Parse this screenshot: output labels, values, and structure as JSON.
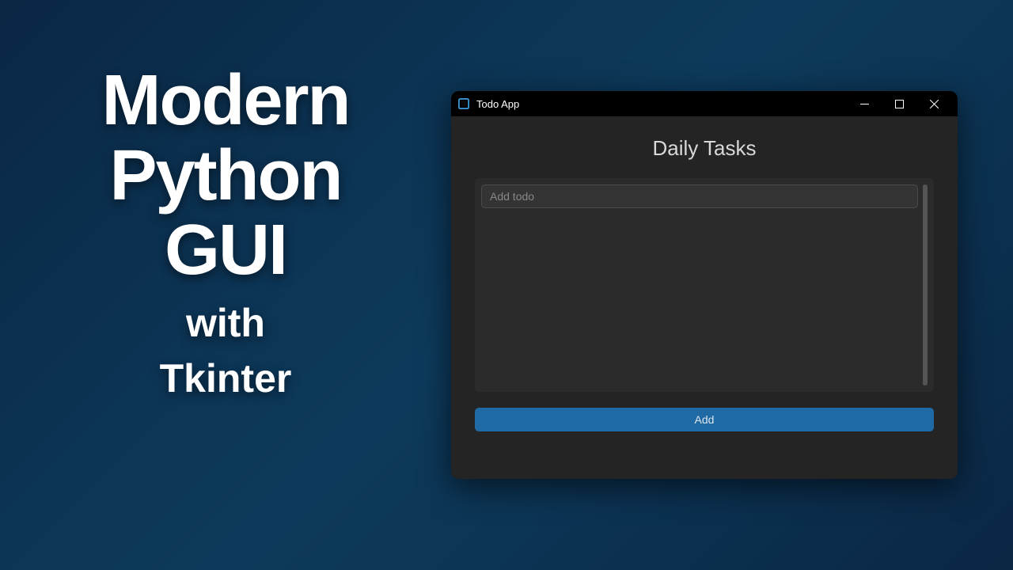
{
  "thumbnail": {
    "line1": "Modern",
    "line2": "Python",
    "line3": "GUI",
    "line4": "with",
    "line5": "Tkinter"
  },
  "window": {
    "title": "Todo App",
    "heading": "Daily Tasks",
    "input_placeholder": "Add todo",
    "input_value": "",
    "add_button_label": "Add"
  },
  "colors": {
    "accent": "#1f6aa5",
    "window_bg": "#242424",
    "panel_bg": "#2b2b2b",
    "input_bg": "#343434"
  }
}
